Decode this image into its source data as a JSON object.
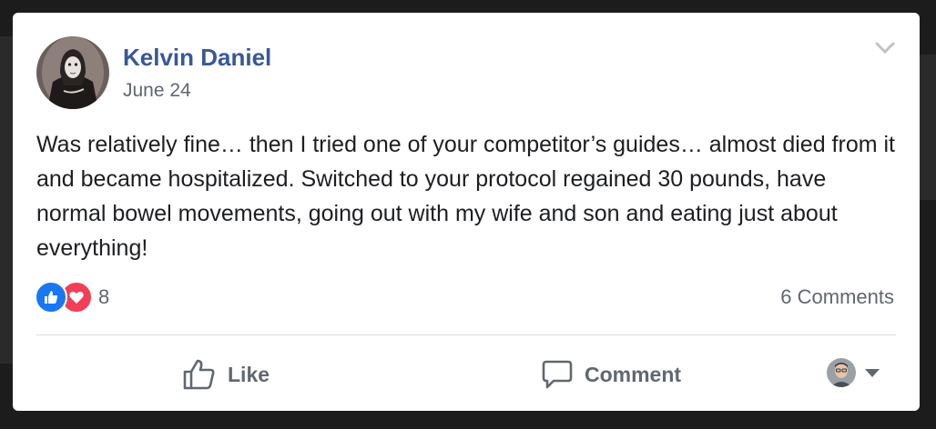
{
  "post": {
    "author": "Kelvin Daniel",
    "date": "June 24",
    "text": "Was relatively fine… then I tried one of your competitor’s guides… almost died from it and became hospitalized. Switched to your protocol regained 30 pounds, have normal bowel movements, going out with my wife and son and eating just about everything!",
    "reaction_icons": [
      "like-icon",
      "love-icon"
    ],
    "reaction_count": "8",
    "comments_count": "6 Comments"
  },
  "actions": {
    "like_label": "Like",
    "comment_label": "Comment"
  },
  "colors": {
    "author": "#385898",
    "secondary_text": "#606770",
    "like_blue": "#1877f2",
    "love_red": "#f33e58"
  }
}
